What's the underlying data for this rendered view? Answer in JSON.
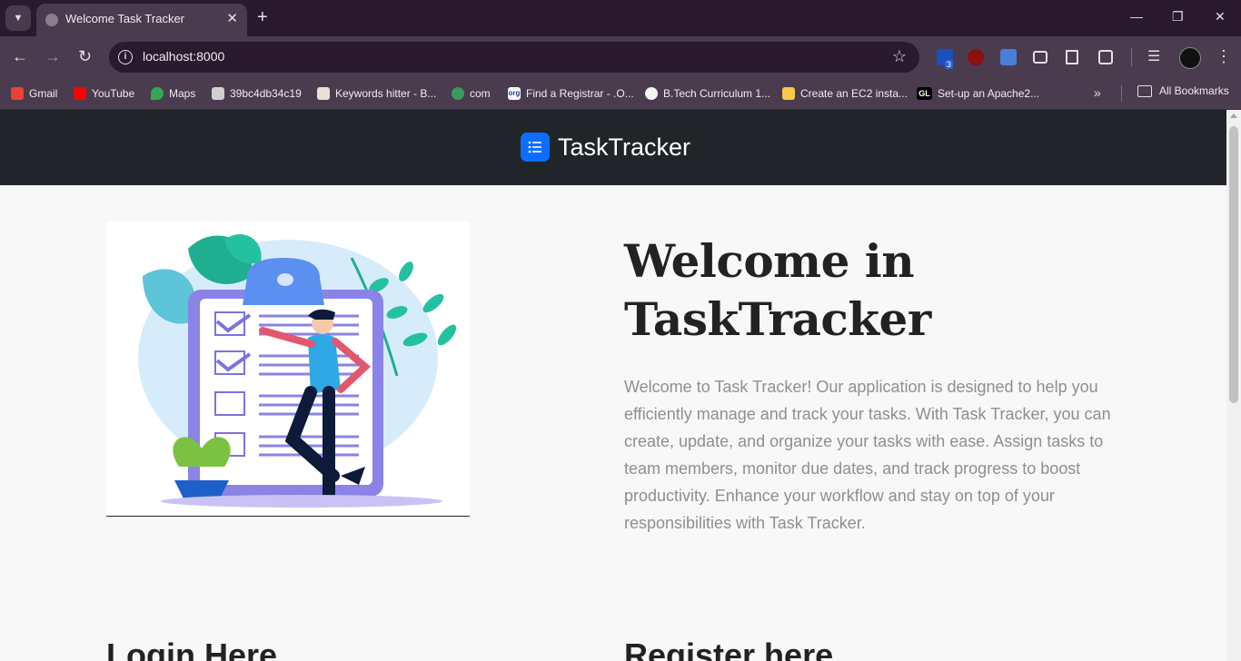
{
  "browser": {
    "tab_title": "Welcome Task Tracker",
    "url": "localhost:8000",
    "extension_badge": "3",
    "bookmarks": [
      {
        "label": "Gmail",
        "icon": "gmail-icon"
      },
      {
        "label": "YouTube",
        "icon": "youtube-icon"
      },
      {
        "label": "Maps",
        "icon": "maps-icon"
      },
      {
        "label": "39bc4db34c19",
        "icon": "bookmark-favicon"
      },
      {
        "label": "Keywords hitter - B...",
        "icon": "bookmark-favicon"
      },
      {
        "label": "com",
        "icon": "globe-icon"
      },
      {
        "label": "Find a Registrar - .O...",
        "icon": "org-icon"
      },
      {
        "label": "B.Tech Curriculum 1...",
        "icon": "bookmark-favicon"
      },
      {
        "label": "Create an EC2 insta...",
        "icon": "bookmark-favicon"
      },
      {
        "label": "Set-up an Apache2...",
        "icon": "gl-icon"
      }
    ],
    "all_bookmarks": "All Bookmarks"
  },
  "navbar": {
    "brand": "TaskTracker"
  },
  "hero": {
    "title": "Welcome in TaskTracker",
    "description": "Welcome to Task Tracker! Our application is designed to help you efficiently manage and track your tasks. With Task Tracker, you can create, update, and organize your tasks with ease. Assign tasks to team members, monitor due dates, and track progress to boost productivity. Enhance your workflow and stay on top of your responsibilities with Task Tracker."
  },
  "sections": {
    "login_title": "Login Here",
    "register_title": "Register here"
  }
}
